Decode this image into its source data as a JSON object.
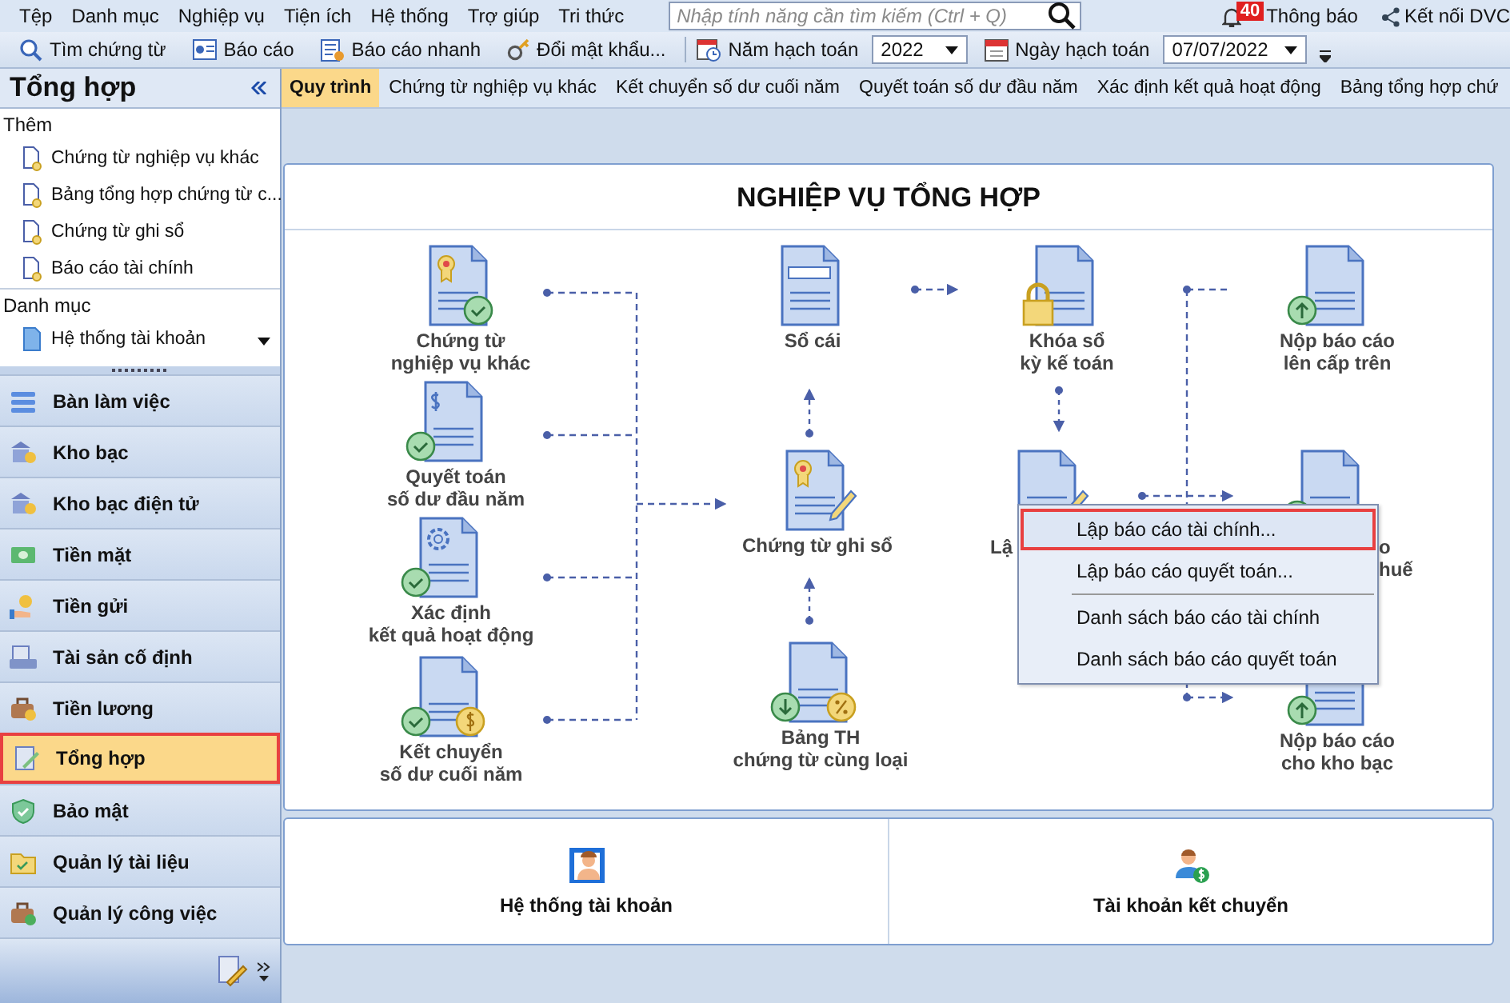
{
  "menu": [
    "Tệp",
    "Danh mục",
    "Nghiệp vụ",
    "Tiện ích",
    "Hệ thống",
    "Trợ giúp",
    "Tri thức"
  ],
  "search": {
    "placeholder": "Nhập tính năng cần tìm kiếm (Ctrl + Q)"
  },
  "notifications": {
    "count": "40",
    "label": "Thông báo"
  },
  "connect": {
    "label": "Kết nối DVC"
  },
  "toolbar": {
    "buttons": [
      "Tìm chứng từ",
      "Báo cáo",
      "Báo cáo nhanh",
      "Đổi mật khẩu..."
    ],
    "year_label": "Năm hạch toán",
    "year": "2022",
    "date_label": "Ngày hạch toán",
    "date": "07/07/2022"
  },
  "sidebar": {
    "title": "Tổng hợp",
    "sections": [
      {
        "heading": "Thêm",
        "items": [
          "Chứng từ nghiệp vụ khác",
          "Bảng tổng hợp chứng từ c...",
          "Chứng từ ghi sổ",
          "Báo cáo tài chính"
        ]
      },
      {
        "heading": "Danh mục",
        "items": [
          "Hệ thống tài khoản"
        ]
      }
    ],
    "nav": [
      {
        "label": "Bàn làm việc",
        "selected": false
      },
      {
        "label": "Kho bạc",
        "selected": false
      },
      {
        "label": "Kho bạc điện tử",
        "selected": false
      },
      {
        "label": "Tiền mặt",
        "selected": false
      },
      {
        "label": "Tiền gửi",
        "selected": false
      },
      {
        "label": "Tài sản cố định",
        "selected": false
      },
      {
        "label": "Tiền lương",
        "selected": false
      },
      {
        "label": "Tổng hợp",
        "selected": true
      },
      {
        "label": "Bảo mật",
        "selected": false
      },
      {
        "label": "Quản lý tài liệu",
        "selected": false
      },
      {
        "label": "Quản lý công việc",
        "selected": false
      }
    ]
  },
  "tabs": [
    {
      "label": "Quy trình",
      "selected": true
    },
    {
      "label": "Chứng từ nghiệp vụ khác",
      "selected": false
    },
    {
      "label": "Kết chuyển số dư cuối năm",
      "selected": false
    },
    {
      "label": "Quyết toán số dư đầu năm",
      "selected": false
    },
    {
      "label": "Xác định kết quả hoạt động",
      "selected": false
    },
    {
      "label": "Bảng tổng hợp chứ",
      "selected": false
    }
  ],
  "diagram": {
    "title": "NGHIỆP VỤ TỔNG HỢP",
    "nodes": [
      {
        "kind": "certificate-check",
        "lines": [
          "Chứng từ",
          "nghiệp vụ khác"
        ]
      },
      {
        "kind": "dollar-check",
        "lines": [
          "Quyết toán",
          "số dư đầu năm"
        ]
      },
      {
        "kind": "gear-check",
        "lines": [
          "Xác định",
          "kết quả hoạt động"
        ]
      },
      {
        "kind": "check-coin",
        "lines": [
          "Kết chuyển",
          "số dư cuối năm"
        ]
      },
      {
        "kind": "form",
        "lines": [
          "Sổ cái"
        ]
      },
      {
        "kind": "certificate-pen",
        "lines": [
          "Chứng từ ghi sổ"
        ]
      },
      {
        "kind": "download-percent",
        "lines": [
          "Bảng TH",
          "chứng từ cùng loại"
        ]
      },
      {
        "kind": "lock",
        "lines": [
          "Khóa sổ",
          "kỳ kế toán"
        ]
      },
      {
        "kind": "pen",
        "lines": [
          "Lậ"
        ]
      },
      {
        "kind": "upload",
        "lines": [
          "Nộp báo cáo",
          "lên cấp trên"
        ]
      },
      {
        "kind": "upload",
        "lines": [
          "o",
          "huế"
        ]
      },
      {
        "kind": "upload",
        "lines": [
          "Nộp báo cáo",
          "cho kho bạc"
        ]
      }
    ],
    "context_menu": [
      {
        "kind": "item",
        "label": "Lập báo cáo tài chính...",
        "selected": true
      },
      {
        "kind": "item",
        "label": "Lập báo cáo quyết toán...",
        "selected": false
      },
      {
        "kind": "divider"
      },
      {
        "kind": "item",
        "label": "Danh sách báo cáo tài chính",
        "selected": false
      },
      {
        "kind": "item",
        "label": "Danh sách báo cáo quyết toán",
        "selected": false
      }
    ]
  },
  "shortcuts": [
    {
      "kind": "account-system",
      "label": "Hệ thống tài khoản"
    },
    {
      "kind": "transfer-account",
      "label": "Tài khoản kết chuyển"
    }
  ]
}
